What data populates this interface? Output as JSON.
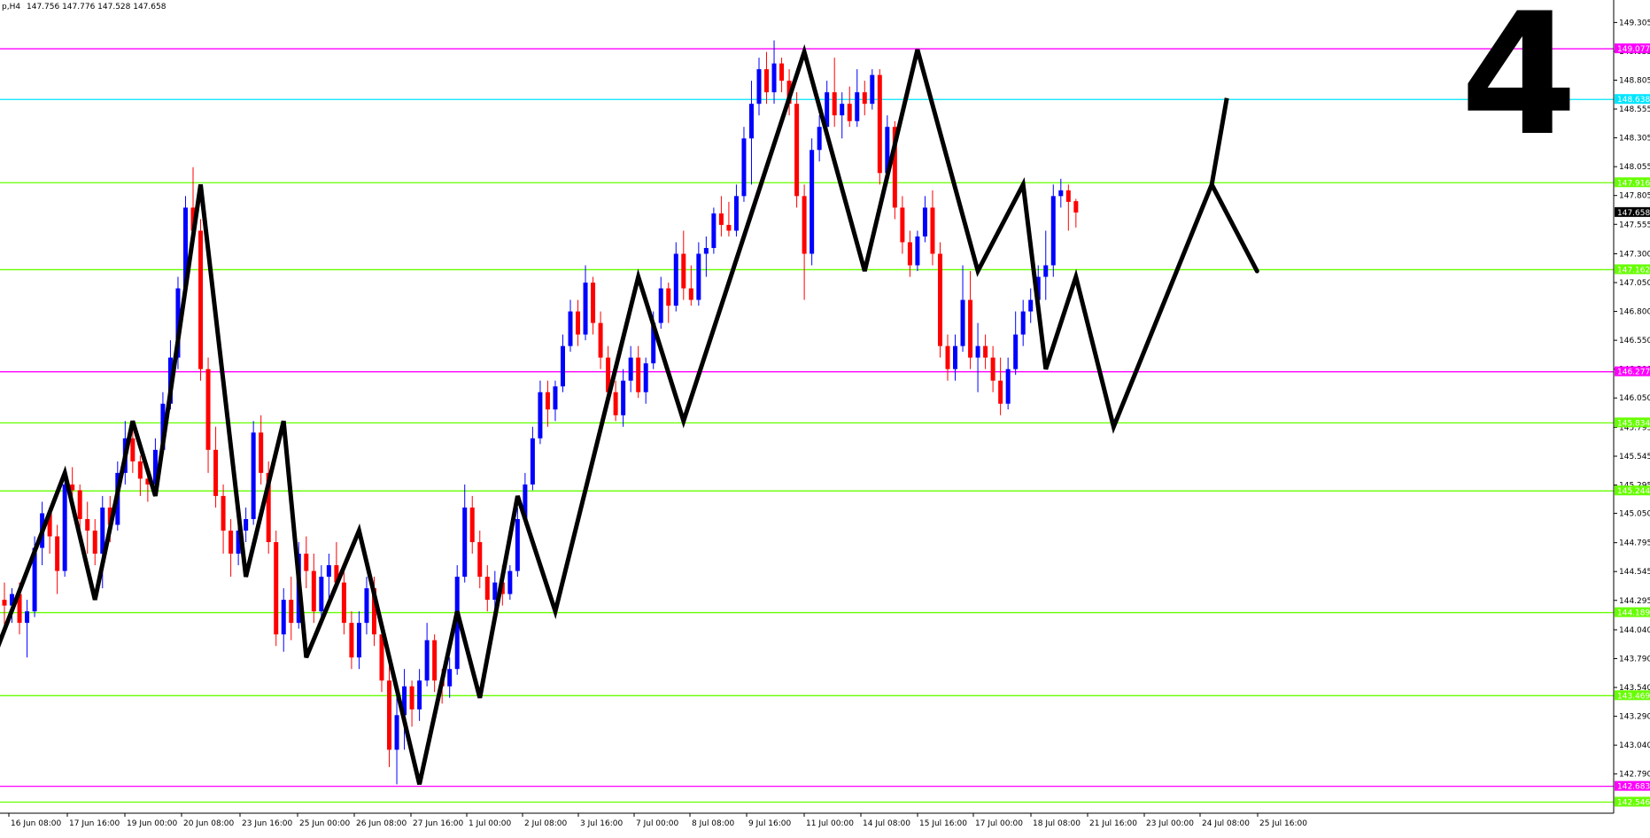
{
  "header": {
    "symbol": "p,H4",
    "ohlc_text": "147.756 147.776 147.528 147.658"
  },
  "overlay_label": "4",
  "colors": {
    "bull": "#0000ff",
    "bear": "#ff0000",
    "zigzag": "#000000",
    "magenta": "#ff00ff",
    "green": "#66ff00",
    "cyan": "#00e5ff"
  },
  "chart_data": {
    "type": "candlestick",
    "y_axis": {
      "min": 142.45,
      "max": 149.5,
      "ticks": [
        "149.305",
        "149.055",
        "148.805",
        "148.555",
        "148.305",
        "148.055",
        "147.805",
        "147.555",
        "147.300",
        "147.050",
        "146.800",
        "146.550",
        "146.300",
        "146.050",
        "145.795",
        "145.545",
        "145.295",
        "145.050",
        "144.795",
        "144.545",
        "144.295",
        "144.040",
        "143.790",
        "143.540",
        "143.290",
        "143.040",
        "142.790"
      ]
    },
    "x_axis": {
      "labels": [
        "16 Jun 08:00",
        "17 Jun 16:00",
        "19 Jun 00:00",
        "20 Jun 08:00",
        "23 Jun 16:00",
        "25 Jun 00:00",
        "26 Jun 08:00",
        "27 Jun 16:00",
        "1 Jul 00:00",
        "2 Jul 08:00",
        "3 Jul 16:00",
        "7 Jul 00:00",
        "8 Jul 08:00",
        "9 Jul 16:00",
        "11 Jul 00:00",
        "14 Jul 08:00",
        "15 Jul 16:00",
        "17 Jul 00:00",
        "18 Jul 08:00",
        "21 Jul 16:00",
        "23 Jul 00:00",
        "24 Jul 08:00",
        "25 Jul 16:00"
      ]
    },
    "levels": [
      {
        "price": 149.077,
        "label": "149.077",
        "color": "magenta"
      },
      {
        "price": 148.638,
        "label": "148.638",
        "color": "cyan"
      },
      {
        "price": 147.916,
        "label": "147.916",
        "color": "green"
      },
      {
        "price": 147.162,
        "label": "147.162",
        "color": "green"
      },
      {
        "price": 146.277,
        "label": "146.277",
        "color": "magenta"
      },
      {
        "price": 145.834,
        "label": "145.834",
        "color": "green"
      },
      {
        "price": 145.244,
        "label": "145.244",
        "color": "green"
      },
      {
        "price": 144.189,
        "label": "144.189",
        "color": "green"
      },
      {
        "price": 143.469,
        "label": "143.469",
        "color": "green"
      },
      {
        "price": 142.683,
        "label": "142.683",
        "color": "magenta"
      },
      {
        "price": 142.546,
        "label": "142.546",
        "color": "green"
      }
    ],
    "current_price": {
      "price": 147.658,
      "label": "147.658"
    },
    "candles": [
      {
        "o": 144.3,
        "h": 144.45,
        "l": 144.05,
        "c": 144.25
      },
      {
        "o": 144.25,
        "h": 144.4,
        "l": 144.1,
        "c": 144.35
      },
      {
        "o": 144.35,
        "h": 144.45,
        "l": 144.0,
        "c": 144.1
      },
      {
        "o": 144.1,
        "h": 144.3,
        "l": 143.8,
        "c": 144.2
      },
      {
        "o": 144.2,
        "h": 144.85,
        "l": 144.15,
        "c": 144.75
      },
      {
        "o": 144.75,
        "h": 145.15,
        "l": 144.6,
        "c": 145.05
      },
      {
        "o": 145.05,
        "h": 145.1,
        "l": 144.7,
        "c": 144.85
      },
      {
        "o": 144.85,
        "h": 144.95,
        "l": 144.35,
        "c": 144.55
      },
      {
        "o": 144.55,
        "h": 145.4,
        "l": 144.5,
        "c": 145.3
      },
      {
        "o": 145.3,
        "h": 145.45,
        "l": 145.1,
        "c": 145.25
      },
      {
        "o": 145.25,
        "h": 145.3,
        "l": 144.9,
        "c": 145.0
      },
      {
        "o": 145.0,
        "h": 145.15,
        "l": 144.7,
        "c": 144.9
      },
      {
        "o": 144.9,
        "h": 145.0,
        "l": 144.6,
        "c": 144.7
      },
      {
        "o": 144.7,
        "h": 145.2,
        "l": 144.4,
        "c": 145.1
      },
      {
        "o": 145.1,
        "h": 145.2,
        "l": 144.8,
        "c": 144.95
      },
      {
        "o": 144.95,
        "h": 145.5,
        "l": 144.9,
        "c": 145.4
      },
      {
        "o": 145.4,
        "h": 145.85,
        "l": 145.3,
        "c": 145.7
      },
      {
        "o": 145.7,
        "h": 145.8,
        "l": 145.4,
        "c": 145.5
      },
      {
        "o": 145.5,
        "h": 145.55,
        "l": 145.2,
        "c": 145.35
      },
      {
        "o": 145.35,
        "h": 145.45,
        "l": 145.15,
        "c": 145.3
      },
      {
        "o": 145.3,
        "h": 145.7,
        "l": 145.25,
        "c": 145.6
      },
      {
        "o": 145.6,
        "h": 146.1,
        "l": 145.55,
        "c": 146.0
      },
      {
        "o": 146.0,
        "h": 146.55,
        "l": 145.95,
        "c": 146.4
      },
      {
        "o": 146.4,
        "h": 147.1,
        "l": 146.3,
        "c": 147.0
      },
      {
        "o": 147.0,
        "h": 147.8,
        "l": 146.95,
        "c": 147.7
      },
      {
        "o": 147.7,
        "h": 148.05,
        "l": 147.4,
        "c": 147.5
      },
      {
        "o": 147.5,
        "h": 147.6,
        "l": 146.2,
        "c": 146.3
      },
      {
        "o": 146.3,
        "h": 146.4,
        "l": 145.4,
        "c": 145.6
      },
      {
        "o": 145.6,
        "h": 145.8,
        "l": 145.1,
        "c": 145.2
      },
      {
        "o": 145.2,
        "h": 145.3,
        "l": 144.7,
        "c": 144.9
      },
      {
        "o": 144.9,
        "h": 145.0,
        "l": 144.5,
        "c": 144.7
      },
      {
        "o": 144.7,
        "h": 145.0,
        "l": 144.6,
        "c": 144.9
      },
      {
        "o": 144.9,
        "h": 145.1,
        "l": 144.8,
        "c": 145.0
      },
      {
        "o": 145.0,
        "h": 145.85,
        "l": 144.95,
        "c": 145.75
      },
      {
        "o": 145.75,
        "h": 145.9,
        "l": 145.3,
        "c": 145.4
      },
      {
        "o": 145.4,
        "h": 145.5,
        "l": 144.7,
        "c": 144.8
      },
      {
        "o": 144.8,
        "h": 144.9,
        "l": 143.9,
        "c": 144.0
      },
      {
        "o": 144.0,
        "h": 144.4,
        "l": 143.85,
        "c": 144.3
      },
      {
        "o": 144.3,
        "h": 144.5,
        "l": 143.95,
        "c": 144.1
      },
      {
        "o": 144.1,
        "h": 144.8,
        "l": 144.05,
        "c": 144.7
      },
      {
        "o": 144.7,
        "h": 144.85,
        "l": 144.4,
        "c": 144.55
      },
      {
        "o": 144.55,
        "h": 144.7,
        "l": 144.1,
        "c": 144.2
      },
      {
        "o": 144.2,
        "h": 144.6,
        "l": 144.1,
        "c": 144.5
      },
      {
        "o": 144.5,
        "h": 144.7,
        "l": 144.3,
        "c": 144.6
      },
      {
        "o": 144.6,
        "h": 144.8,
        "l": 144.4,
        "c": 144.45
      },
      {
        "o": 144.45,
        "h": 144.6,
        "l": 144.0,
        "c": 144.1
      },
      {
        "o": 144.1,
        "h": 144.2,
        "l": 143.7,
        "c": 143.8
      },
      {
        "o": 143.8,
        "h": 144.2,
        "l": 143.7,
        "c": 144.1
      },
      {
        "o": 144.1,
        "h": 144.5,
        "l": 144.0,
        "c": 144.4
      },
      {
        "o": 144.4,
        "h": 144.5,
        "l": 143.9,
        "c": 144.0
      },
      {
        "o": 144.0,
        "h": 144.1,
        "l": 143.5,
        "c": 143.6
      },
      {
        "o": 143.6,
        "h": 143.8,
        "l": 142.85,
        "c": 143.0
      },
      {
        "o": 143.0,
        "h": 143.5,
        "l": 142.7,
        "c": 143.3
      },
      {
        "o": 143.3,
        "h": 143.7,
        "l": 143.0,
        "c": 143.55
      },
      {
        "o": 143.55,
        "h": 143.6,
        "l": 143.2,
        "c": 143.35
      },
      {
        "o": 143.35,
        "h": 143.7,
        "l": 143.25,
        "c": 143.6
      },
      {
        "o": 143.6,
        "h": 144.1,
        "l": 143.55,
        "c": 143.95
      },
      {
        "o": 143.95,
        "h": 144.0,
        "l": 143.5,
        "c": 143.6
      },
      {
        "o": 143.6,
        "h": 143.7,
        "l": 143.4,
        "c": 143.55
      },
      {
        "o": 143.55,
        "h": 143.8,
        "l": 143.45,
        "c": 143.7
      },
      {
        "o": 143.7,
        "h": 144.6,
        "l": 143.65,
        "c": 144.5
      },
      {
        "o": 144.5,
        "h": 145.3,
        "l": 144.45,
        "c": 145.1
      },
      {
        "o": 145.1,
        "h": 145.2,
        "l": 144.7,
        "c": 144.8
      },
      {
        "o": 144.8,
        "h": 144.9,
        "l": 144.4,
        "c": 144.5
      },
      {
        "o": 144.5,
        "h": 144.6,
        "l": 144.2,
        "c": 144.3
      },
      {
        "o": 144.3,
        "h": 144.55,
        "l": 144.2,
        "c": 144.45
      },
      {
        "o": 144.45,
        "h": 144.6,
        "l": 144.25,
        "c": 144.35
      },
      {
        "o": 144.35,
        "h": 144.6,
        "l": 144.3,
        "c": 144.55
      },
      {
        "o": 144.55,
        "h": 145.1,
        "l": 144.5,
        "c": 145.0
      },
      {
        "o": 145.0,
        "h": 145.4,
        "l": 144.95,
        "c": 145.3
      },
      {
        "o": 145.3,
        "h": 145.8,
        "l": 145.25,
        "c": 145.7
      },
      {
        "o": 145.7,
        "h": 146.2,
        "l": 145.65,
        "c": 146.1
      },
      {
        "o": 146.1,
        "h": 146.2,
        "l": 145.8,
        "c": 145.95
      },
      {
        "o": 145.95,
        "h": 146.2,
        "l": 145.85,
        "c": 146.15
      },
      {
        "o": 146.15,
        "h": 146.6,
        "l": 146.1,
        "c": 146.5
      },
      {
        "o": 146.5,
        "h": 146.9,
        "l": 146.45,
        "c": 146.8
      },
      {
        "o": 146.8,
        "h": 146.9,
        "l": 146.5,
        "c": 146.6
      },
      {
        "o": 146.6,
        "h": 147.2,
        "l": 146.55,
        "c": 147.05
      },
      {
        "o": 147.05,
        "h": 147.1,
        "l": 146.6,
        "c": 146.7
      },
      {
        "o": 146.7,
        "h": 146.8,
        "l": 146.3,
        "c": 146.4
      },
      {
        "o": 146.4,
        "h": 146.5,
        "l": 146.0,
        "c": 146.1
      },
      {
        "o": 146.1,
        "h": 146.2,
        "l": 145.85,
        "c": 145.9
      },
      {
        "o": 145.9,
        "h": 146.3,
        "l": 145.8,
        "c": 146.2
      },
      {
        "o": 146.2,
        "h": 146.5,
        "l": 146.1,
        "c": 146.4
      },
      {
        "o": 146.4,
        "h": 146.5,
        "l": 146.05,
        "c": 146.1
      },
      {
        "o": 146.1,
        "h": 146.4,
        "l": 146.0,
        "c": 146.35
      },
      {
        "o": 146.35,
        "h": 146.8,
        "l": 146.3,
        "c": 146.7
      },
      {
        "o": 146.7,
        "h": 147.1,
        "l": 146.65,
        "c": 147.0
      },
      {
        "o": 147.0,
        "h": 147.05,
        "l": 146.7,
        "c": 146.85
      },
      {
        "o": 146.85,
        "h": 147.4,
        "l": 146.8,
        "c": 147.3
      },
      {
        "o": 147.3,
        "h": 147.5,
        "l": 146.9,
        "c": 147.0
      },
      {
        "o": 147.0,
        "h": 147.2,
        "l": 146.85,
        "c": 146.9
      },
      {
        "o": 146.9,
        "h": 147.4,
        "l": 146.85,
        "c": 147.3
      },
      {
        "o": 147.3,
        "h": 147.45,
        "l": 147.1,
        "c": 147.35
      },
      {
        "o": 147.35,
        "h": 147.7,
        "l": 147.3,
        "c": 147.65
      },
      {
        "o": 147.65,
        "h": 147.8,
        "l": 147.45,
        "c": 147.55
      },
      {
        "o": 147.55,
        "h": 147.75,
        "l": 147.45,
        "c": 147.5
      },
      {
        "o": 147.5,
        "h": 147.9,
        "l": 147.45,
        "c": 147.8
      },
      {
        "o": 147.8,
        "h": 148.4,
        "l": 147.75,
        "c": 148.3
      },
      {
        "o": 148.3,
        "h": 148.8,
        "l": 147.9,
        "c": 148.6
      },
      {
        "o": 148.6,
        "h": 149.0,
        "l": 148.5,
        "c": 148.9
      },
      {
        "o": 148.9,
        "h": 149.05,
        "l": 148.6,
        "c": 148.7
      },
      {
        "o": 148.7,
        "h": 149.15,
        "l": 148.6,
        "c": 148.95
      },
      {
        "o": 148.95,
        "h": 149.0,
        "l": 148.7,
        "c": 148.8
      },
      {
        "o": 148.8,
        "h": 148.9,
        "l": 148.5,
        "c": 148.6
      },
      {
        "o": 148.6,
        "h": 148.7,
        "l": 147.7,
        "c": 147.8
      },
      {
        "o": 147.8,
        "h": 147.9,
        "l": 146.9,
        "c": 147.3
      },
      {
        "o": 147.3,
        "h": 148.3,
        "l": 147.2,
        "c": 148.2
      },
      {
        "o": 148.2,
        "h": 148.5,
        "l": 148.1,
        "c": 148.4
      },
      {
        "o": 148.4,
        "h": 148.8,
        "l": 148.3,
        "c": 148.7
      },
      {
        "o": 148.7,
        "h": 149.0,
        "l": 148.4,
        "c": 148.5
      },
      {
        "o": 148.5,
        "h": 148.7,
        "l": 148.3,
        "c": 148.6
      },
      {
        "o": 148.6,
        "h": 148.75,
        "l": 148.4,
        "c": 148.45
      },
      {
        "o": 148.45,
        "h": 148.9,
        "l": 148.4,
        "c": 148.7
      },
      {
        "o": 148.7,
        "h": 148.8,
        "l": 148.5,
        "c": 148.6
      },
      {
        "o": 148.6,
        "h": 148.9,
        "l": 148.55,
        "c": 148.85
      },
      {
        "o": 148.85,
        "h": 148.9,
        "l": 147.9,
        "c": 148.0
      },
      {
        "o": 148.0,
        "h": 148.5,
        "l": 147.9,
        "c": 148.4
      },
      {
        "o": 148.4,
        "h": 148.45,
        "l": 147.6,
        "c": 147.7
      },
      {
        "o": 147.7,
        "h": 147.8,
        "l": 147.3,
        "c": 147.4
      },
      {
        "o": 147.4,
        "h": 147.5,
        "l": 147.1,
        "c": 147.2
      },
      {
        "o": 147.2,
        "h": 147.5,
        "l": 147.15,
        "c": 147.45
      },
      {
        "o": 147.45,
        "h": 147.8,
        "l": 147.4,
        "c": 147.7
      },
      {
        "o": 147.7,
        "h": 147.85,
        "l": 147.2,
        "c": 147.3
      },
      {
        "o": 147.3,
        "h": 147.4,
        "l": 146.4,
        "c": 146.5
      },
      {
        "o": 146.5,
        "h": 146.6,
        "l": 146.2,
        "c": 146.3
      },
      {
        "o": 146.3,
        "h": 146.6,
        "l": 146.2,
        "c": 146.5
      },
      {
        "o": 146.5,
        "h": 147.2,
        "l": 146.45,
        "c": 146.9
      },
      {
        "o": 146.9,
        "h": 147.15,
        "l": 146.3,
        "c": 146.4
      },
      {
        "o": 146.4,
        "h": 146.7,
        "l": 146.1,
        "c": 146.5
      },
      {
        "o": 146.5,
        "h": 146.6,
        "l": 146.3,
        "c": 146.4
      },
      {
        "o": 146.4,
        "h": 146.5,
        "l": 146.1,
        "c": 146.2
      },
      {
        "o": 146.2,
        "h": 146.4,
        "l": 145.9,
        "c": 146.0
      },
      {
        "o": 146.0,
        "h": 146.4,
        "l": 145.95,
        "c": 146.3
      },
      {
        "o": 146.3,
        "h": 146.8,
        "l": 146.25,
        "c": 146.6
      },
      {
        "o": 146.6,
        "h": 146.9,
        "l": 146.5,
        "c": 146.8
      },
      {
        "o": 146.8,
        "h": 147.0,
        "l": 146.7,
        "c": 146.9
      },
      {
        "o": 146.9,
        "h": 147.2,
        "l": 146.8,
        "c": 147.1
      },
      {
        "o": 147.1,
        "h": 147.5,
        "l": 146.9,
        "c": 147.2
      },
      {
        "o": 147.2,
        "h": 147.9,
        "l": 147.1,
        "c": 147.8
      },
      {
        "o": 147.8,
        "h": 147.95,
        "l": 147.7,
        "c": 147.85
      },
      {
        "o": 147.85,
        "h": 147.9,
        "l": 147.5,
        "c": 147.75
      },
      {
        "o": 147.756,
        "h": 147.776,
        "l": 147.528,
        "c": 147.658
      }
    ],
    "zigzag": [
      {
        "i": -2,
        "p": 143.7
      },
      {
        "i": 8,
        "p": 145.4
      },
      {
        "i": 12,
        "p": 144.3
      },
      {
        "i": 17,
        "p": 145.85
      },
      {
        "i": 20,
        "p": 145.2
      },
      {
        "i": 26,
        "p": 147.9
      },
      {
        "i": 32,
        "p": 144.5
      },
      {
        "i": 37,
        "p": 145.85
      },
      {
        "i": 40,
        "p": 143.8
      },
      {
        "i": 47,
        "p": 144.9
      },
      {
        "i": 55,
        "p": 142.7
      },
      {
        "i": 60,
        "p": 144.2
      },
      {
        "i": 63,
        "p": 143.45
      },
      {
        "i": 68,
        "p": 145.2
      },
      {
        "i": 73,
        "p": 144.2
      },
      {
        "i": 84,
        "p": 147.1
      },
      {
        "i": 90,
        "p": 145.85
      },
      {
        "i": 106,
        "p": 149.05
      },
      {
        "i": 114,
        "p": 147.15
      },
      {
        "i": 121,
        "p": 149.07
      },
      {
        "i": 129,
        "p": 147.15
      },
      {
        "i": 135,
        "p": 147.9
      },
      {
        "i": 138,
        "p": 146.3
      },
      {
        "i": 142,
        "p": 147.1
      },
      {
        "i": 147,
        "p": 145.8
      },
      {
        "i": 160,
        "p": 147.9
      },
      {
        "i": 162,
        "p": 148.65
      },
      {
        "i": 160,
        "p": 147.9
      },
      {
        "i": 166,
        "p": 147.15
      }
    ]
  }
}
